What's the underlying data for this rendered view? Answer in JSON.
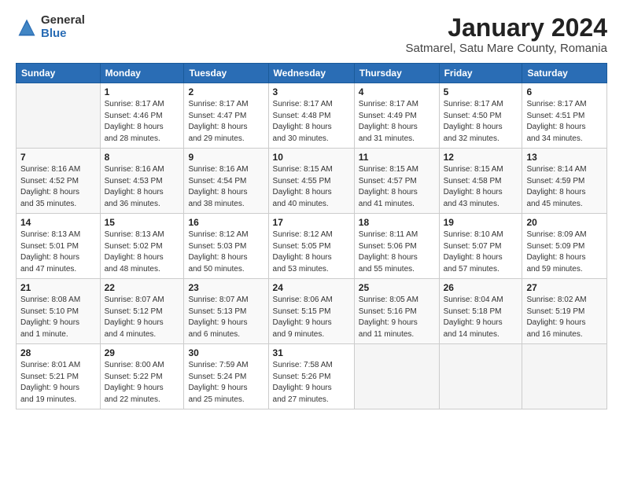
{
  "header": {
    "logo_general": "General",
    "logo_blue": "Blue",
    "title": "January 2024",
    "subtitle": "Satmarel, Satu Mare County, Romania"
  },
  "days_of_week": [
    "Sunday",
    "Monday",
    "Tuesday",
    "Wednesday",
    "Thursday",
    "Friday",
    "Saturday"
  ],
  "weeks": [
    [
      {
        "day": "",
        "info": ""
      },
      {
        "day": "1",
        "info": "Sunrise: 8:17 AM\nSunset: 4:46 PM\nDaylight: 8 hours\nand 28 minutes."
      },
      {
        "day": "2",
        "info": "Sunrise: 8:17 AM\nSunset: 4:47 PM\nDaylight: 8 hours\nand 29 minutes."
      },
      {
        "day": "3",
        "info": "Sunrise: 8:17 AM\nSunset: 4:48 PM\nDaylight: 8 hours\nand 30 minutes."
      },
      {
        "day": "4",
        "info": "Sunrise: 8:17 AM\nSunset: 4:49 PM\nDaylight: 8 hours\nand 31 minutes."
      },
      {
        "day": "5",
        "info": "Sunrise: 8:17 AM\nSunset: 4:50 PM\nDaylight: 8 hours\nand 32 minutes."
      },
      {
        "day": "6",
        "info": "Sunrise: 8:17 AM\nSunset: 4:51 PM\nDaylight: 8 hours\nand 34 minutes."
      }
    ],
    [
      {
        "day": "7",
        "info": "Sunrise: 8:16 AM\nSunset: 4:52 PM\nDaylight: 8 hours\nand 35 minutes."
      },
      {
        "day": "8",
        "info": "Sunrise: 8:16 AM\nSunset: 4:53 PM\nDaylight: 8 hours\nand 36 minutes."
      },
      {
        "day": "9",
        "info": "Sunrise: 8:16 AM\nSunset: 4:54 PM\nDaylight: 8 hours\nand 38 minutes."
      },
      {
        "day": "10",
        "info": "Sunrise: 8:15 AM\nSunset: 4:55 PM\nDaylight: 8 hours\nand 40 minutes."
      },
      {
        "day": "11",
        "info": "Sunrise: 8:15 AM\nSunset: 4:57 PM\nDaylight: 8 hours\nand 41 minutes."
      },
      {
        "day": "12",
        "info": "Sunrise: 8:15 AM\nSunset: 4:58 PM\nDaylight: 8 hours\nand 43 minutes."
      },
      {
        "day": "13",
        "info": "Sunrise: 8:14 AM\nSunset: 4:59 PM\nDaylight: 8 hours\nand 45 minutes."
      }
    ],
    [
      {
        "day": "14",
        "info": "Sunrise: 8:13 AM\nSunset: 5:01 PM\nDaylight: 8 hours\nand 47 minutes."
      },
      {
        "day": "15",
        "info": "Sunrise: 8:13 AM\nSunset: 5:02 PM\nDaylight: 8 hours\nand 48 minutes."
      },
      {
        "day": "16",
        "info": "Sunrise: 8:12 AM\nSunset: 5:03 PM\nDaylight: 8 hours\nand 50 minutes."
      },
      {
        "day": "17",
        "info": "Sunrise: 8:12 AM\nSunset: 5:05 PM\nDaylight: 8 hours\nand 53 minutes."
      },
      {
        "day": "18",
        "info": "Sunrise: 8:11 AM\nSunset: 5:06 PM\nDaylight: 8 hours\nand 55 minutes."
      },
      {
        "day": "19",
        "info": "Sunrise: 8:10 AM\nSunset: 5:07 PM\nDaylight: 8 hours\nand 57 minutes."
      },
      {
        "day": "20",
        "info": "Sunrise: 8:09 AM\nSunset: 5:09 PM\nDaylight: 8 hours\nand 59 minutes."
      }
    ],
    [
      {
        "day": "21",
        "info": "Sunrise: 8:08 AM\nSunset: 5:10 PM\nDaylight: 9 hours\nand 1 minute."
      },
      {
        "day": "22",
        "info": "Sunrise: 8:07 AM\nSunset: 5:12 PM\nDaylight: 9 hours\nand 4 minutes."
      },
      {
        "day": "23",
        "info": "Sunrise: 8:07 AM\nSunset: 5:13 PM\nDaylight: 9 hours\nand 6 minutes."
      },
      {
        "day": "24",
        "info": "Sunrise: 8:06 AM\nSunset: 5:15 PM\nDaylight: 9 hours\nand 9 minutes."
      },
      {
        "day": "25",
        "info": "Sunrise: 8:05 AM\nSunset: 5:16 PM\nDaylight: 9 hours\nand 11 minutes."
      },
      {
        "day": "26",
        "info": "Sunrise: 8:04 AM\nSunset: 5:18 PM\nDaylight: 9 hours\nand 14 minutes."
      },
      {
        "day": "27",
        "info": "Sunrise: 8:02 AM\nSunset: 5:19 PM\nDaylight: 9 hours\nand 16 minutes."
      }
    ],
    [
      {
        "day": "28",
        "info": "Sunrise: 8:01 AM\nSunset: 5:21 PM\nDaylight: 9 hours\nand 19 minutes."
      },
      {
        "day": "29",
        "info": "Sunrise: 8:00 AM\nSunset: 5:22 PM\nDaylight: 9 hours\nand 22 minutes."
      },
      {
        "day": "30",
        "info": "Sunrise: 7:59 AM\nSunset: 5:24 PM\nDaylight: 9 hours\nand 25 minutes."
      },
      {
        "day": "31",
        "info": "Sunrise: 7:58 AM\nSunset: 5:26 PM\nDaylight: 9 hours\nand 27 minutes."
      },
      {
        "day": "",
        "info": ""
      },
      {
        "day": "",
        "info": ""
      },
      {
        "day": "",
        "info": ""
      }
    ]
  ]
}
